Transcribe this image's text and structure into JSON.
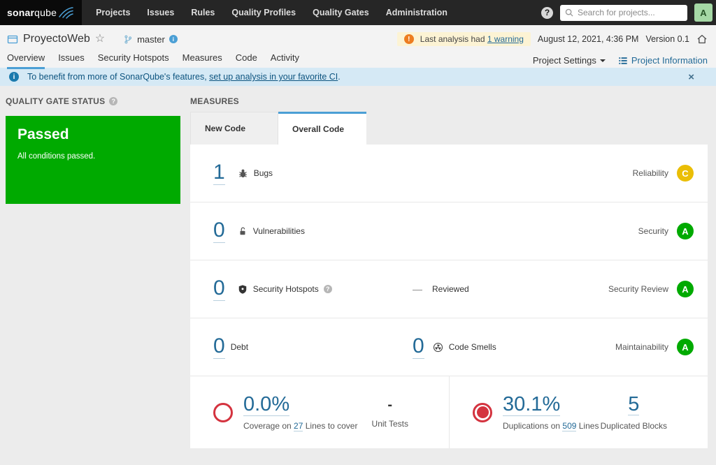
{
  "nav": {
    "logo_bold": "sonar",
    "logo_light": "qube",
    "items": [
      "Projects",
      "Issues",
      "Rules",
      "Quality Profiles",
      "Quality Gates",
      "Administration"
    ],
    "help": "?",
    "search_placeholder": "Search for projects...",
    "avatar": "A"
  },
  "header": {
    "project_name": "ProyectoWeb",
    "star": "☆",
    "branch": "master",
    "warning_prefix": "Last analysis had",
    "warning_link": "1 warning",
    "date": "August 12, 2021, 4:36 PM",
    "version": "Version 0.1",
    "tabs": [
      "Overview",
      "Issues",
      "Security Hotspots",
      "Measures",
      "Code",
      "Activity"
    ],
    "active_tab": "Overview",
    "project_settings": "Project Settings",
    "project_information": "Project Information"
  },
  "banner": {
    "text_prefix": "To benefit from more of SonarQube's features, ",
    "link": "set up analysis in your favorite CI",
    "text_suffix": ".",
    "close": "×"
  },
  "quality_gate": {
    "title": "QUALITY GATE STATUS",
    "status": "Passed",
    "subtitle": "All conditions passed."
  },
  "measures": {
    "title": "MEASURES",
    "tabs": [
      "New Code",
      "Overall Code"
    ],
    "active_tab": "Overall Code",
    "rows": [
      {
        "value": "1",
        "label": "Bugs",
        "rating": "C",
        "rating_label": "Reliability",
        "rating_color": "#eabe06"
      },
      {
        "value": "0",
        "label": "Vulnerabilities",
        "rating": "A",
        "rating_label": "Security",
        "rating_color": "#00aa00"
      },
      {
        "value": "0",
        "label": "Security Hotspots",
        "middle_dash": "—",
        "middle_label": "Reviewed",
        "rating": "A",
        "rating_label": "Security Review",
        "rating_color": "#00aa00"
      },
      {
        "value": "0",
        "label": "Debt",
        "middle_value": "0",
        "middle_label": "Code Smells",
        "rating": "A",
        "rating_label": "Maintainability",
        "rating_color": "#00aa00"
      }
    ],
    "coverage": {
      "value": "0.0%",
      "desc_prefix": "Coverage on ",
      "desc_link": "27",
      "desc_suffix": " Lines to cover",
      "secondary_value": "-",
      "secondary_label": "Unit Tests"
    },
    "duplications": {
      "value": "30.1%",
      "desc_prefix": "Duplications on ",
      "desc_link": "509",
      "desc_suffix": " Lines",
      "secondary_value": "5",
      "secondary_label": "Duplicated Blocks"
    }
  },
  "colors": {
    "quality_gate_green": "#00aa00",
    "rating_a": "#00aa00",
    "rating_c": "#eabe06",
    "accent_blue": "#4b9fd5",
    "link_blue": "#236a97",
    "error_red": "#d4333f"
  }
}
